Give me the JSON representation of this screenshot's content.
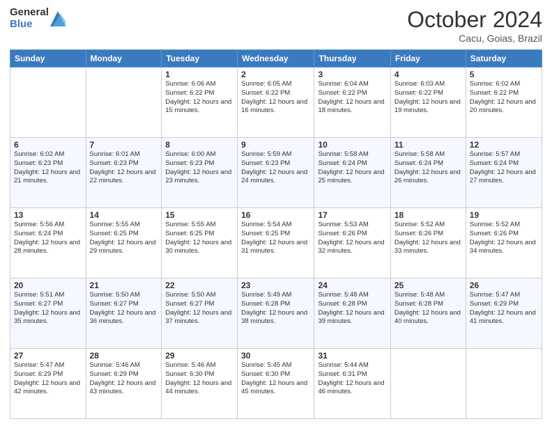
{
  "logo": {
    "general": "General",
    "blue": "Blue"
  },
  "title": "October 2024",
  "location": "Cacu, Goias, Brazil",
  "days_of_week": [
    "Sunday",
    "Monday",
    "Tuesday",
    "Wednesday",
    "Thursday",
    "Friday",
    "Saturday"
  ],
  "weeks": [
    [
      {
        "day": "",
        "info": ""
      },
      {
        "day": "",
        "info": ""
      },
      {
        "day": "1",
        "info": "Sunrise: 6:06 AM\nSunset: 6:22 PM\nDaylight: 12 hours and 15 minutes."
      },
      {
        "day": "2",
        "info": "Sunrise: 6:05 AM\nSunset: 6:22 PM\nDaylight: 12 hours and 16 minutes."
      },
      {
        "day": "3",
        "info": "Sunrise: 6:04 AM\nSunset: 6:22 PM\nDaylight: 12 hours and 18 minutes."
      },
      {
        "day": "4",
        "info": "Sunrise: 6:03 AM\nSunset: 6:22 PM\nDaylight: 12 hours and 19 minutes."
      },
      {
        "day": "5",
        "info": "Sunrise: 6:02 AM\nSunset: 6:22 PM\nDaylight: 12 hours and 20 minutes."
      }
    ],
    [
      {
        "day": "6",
        "info": "Sunrise: 6:02 AM\nSunset: 6:23 PM\nDaylight: 12 hours and 21 minutes."
      },
      {
        "day": "7",
        "info": "Sunrise: 6:01 AM\nSunset: 6:23 PM\nDaylight: 12 hours and 22 minutes."
      },
      {
        "day": "8",
        "info": "Sunrise: 6:00 AM\nSunset: 6:23 PM\nDaylight: 12 hours and 23 minutes."
      },
      {
        "day": "9",
        "info": "Sunrise: 5:59 AM\nSunset: 6:23 PM\nDaylight: 12 hours and 24 minutes."
      },
      {
        "day": "10",
        "info": "Sunrise: 5:58 AM\nSunset: 6:24 PM\nDaylight: 12 hours and 25 minutes."
      },
      {
        "day": "11",
        "info": "Sunrise: 5:58 AM\nSunset: 6:24 PM\nDaylight: 12 hours and 26 minutes."
      },
      {
        "day": "12",
        "info": "Sunrise: 5:57 AM\nSunset: 6:24 PM\nDaylight: 12 hours and 27 minutes."
      }
    ],
    [
      {
        "day": "13",
        "info": "Sunrise: 5:56 AM\nSunset: 6:24 PM\nDaylight: 12 hours and 28 minutes."
      },
      {
        "day": "14",
        "info": "Sunrise: 5:55 AM\nSunset: 6:25 PM\nDaylight: 12 hours and 29 minutes."
      },
      {
        "day": "15",
        "info": "Sunrise: 5:55 AM\nSunset: 6:25 PM\nDaylight: 12 hours and 30 minutes."
      },
      {
        "day": "16",
        "info": "Sunrise: 5:54 AM\nSunset: 6:25 PM\nDaylight: 12 hours and 31 minutes."
      },
      {
        "day": "17",
        "info": "Sunrise: 5:53 AM\nSunset: 6:26 PM\nDaylight: 12 hours and 32 minutes."
      },
      {
        "day": "18",
        "info": "Sunrise: 5:52 AM\nSunset: 6:26 PM\nDaylight: 12 hours and 33 minutes."
      },
      {
        "day": "19",
        "info": "Sunrise: 5:52 AM\nSunset: 6:26 PM\nDaylight: 12 hours and 34 minutes."
      }
    ],
    [
      {
        "day": "20",
        "info": "Sunrise: 5:51 AM\nSunset: 6:27 PM\nDaylight: 12 hours and 35 minutes."
      },
      {
        "day": "21",
        "info": "Sunrise: 5:50 AM\nSunset: 6:27 PM\nDaylight: 12 hours and 36 minutes."
      },
      {
        "day": "22",
        "info": "Sunrise: 5:50 AM\nSunset: 6:27 PM\nDaylight: 12 hours and 37 minutes."
      },
      {
        "day": "23",
        "info": "Sunrise: 5:49 AM\nSunset: 6:28 PM\nDaylight: 12 hours and 38 minutes."
      },
      {
        "day": "24",
        "info": "Sunrise: 5:48 AM\nSunset: 6:28 PM\nDaylight: 12 hours and 39 minutes."
      },
      {
        "day": "25",
        "info": "Sunrise: 5:48 AM\nSunset: 6:28 PM\nDaylight: 12 hours and 40 minutes."
      },
      {
        "day": "26",
        "info": "Sunrise: 5:47 AM\nSunset: 6:29 PM\nDaylight: 12 hours and 41 minutes."
      }
    ],
    [
      {
        "day": "27",
        "info": "Sunrise: 5:47 AM\nSunset: 6:29 PM\nDaylight: 12 hours and 42 minutes."
      },
      {
        "day": "28",
        "info": "Sunrise: 5:46 AM\nSunset: 6:29 PM\nDaylight: 12 hours and 43 minutes."
      },
      {
        "day": "29",
        "info": "Sunrise: 5:46 AM\nSunset: 6:30 PM\nDaylight: 12 hours and 44 minutes."
      },
      {
        "day": "30",
        "info": "Sunrise: 5:45 AM\nSunset: 6:30 PM\nDaylight: 12 hours and 45 minutes."
      },
      {
        "day": "31",
        "info": "Sunrise: 5:44 AM\nSunset: 6:31 PM\nDaylight: 12 hours and 46 minutes."
      },
      {
        "day": "",
        "info": ""
      },
      {
        "day": "",
        "info": ""
      }
    ]
  ]
}
